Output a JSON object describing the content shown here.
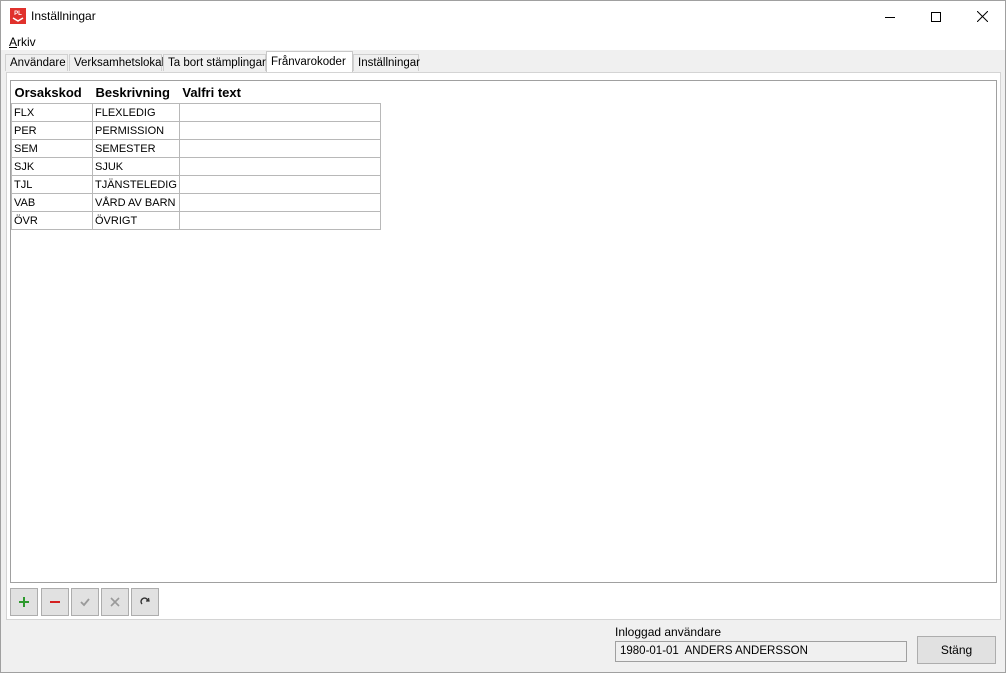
{
  "window": {
    "title": "Inställningar"
  },
  "menu": {
    "arkiv_first": "A",
    "arkiv_rest": "rkiv"
  },
  "tabs": [
    {
      "label": "Användare"
    },
    {
      "label": "Verksamhetslokal"
    },
    {
      "label": "Ta bort stämplingar"
    },
    {
      "label": "Frånvarokoder"
    },
    {
      "label": "Inställningar"
    }
  ],
  "active_tab": "Frånvarokoder",
  "grid": {
    "headers": [
      "Orsakskod",
      "Beskrivning",
      "Valfri text"
    ],
    "rows": [
      {
        "code": "FLX",
        "desc": "FLEXLEDIG",
        "text": ""
      },
      {
        "code": "PER",
        "desc": "PERMISSION",
        "text": ""
      },
      {
        "code": "SEM",
        "desc": "SEMESTER",
        "text": ""
      },
      {
        "code": "SJK",
        "desc": "SJUK",
        "text": ""
      },
      {
        "code": "TJL",
        "desc": "TJÄNSTELEDIG",
        "text": ""
      },
      {
        "code": "VAB",
        "desc": "VÅRD AV BARN",
        "text": ""
      },
      {
        "code": "ÖVR",
        "desc": "ÖVRIGT",
        "text": ""
      }
    ]
  },
  "status": {
    "label": "Inloggad användare",
    "value": "1980-01-01  ANDERS ANDERSSON"
  },
  "buttons": {
    "close": "Stäng"
  },
  "app_icon_text": "PL",
  "colors": {
    "add": "#2e9a2e",
    "remove": "#d42020",
    "disabled": "#9a9a9a",
    "icon_red": "#e0312c"
  }
}
